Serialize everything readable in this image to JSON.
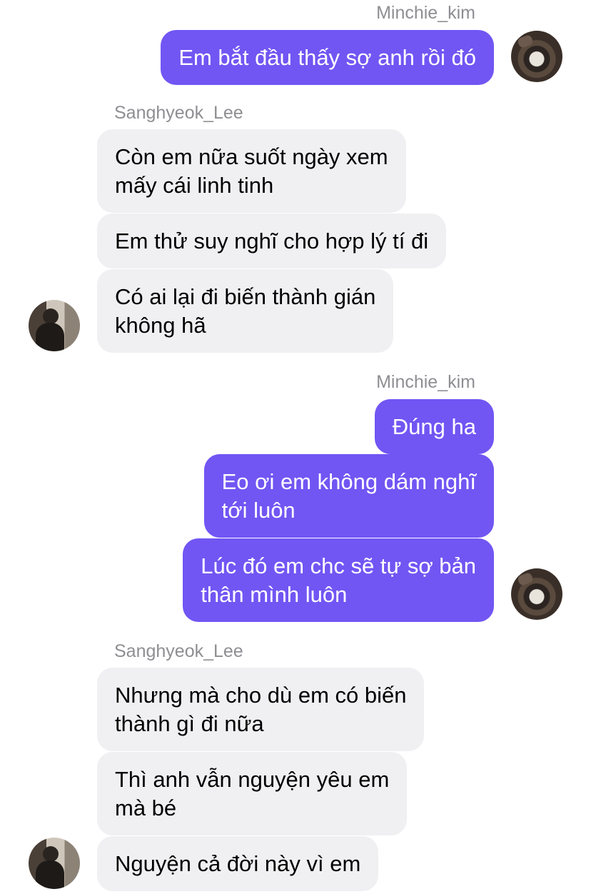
{
  "participants": {
    "me": "Minchie_kim",
    "other": "Sanghyeok_Lee"
  },
  "groups": [
    {
      "sender_label": "Minchie_kim",
      "messages": [
        "Em bắt đầu thấy sợ anh rồi đó"
      ]
    },
    {
      "sender_label": "Sanghyeok_Lee",
      "messages": [
        "Còn em nữa suốt ngày xem\nmấy cái linh tinh",
        "Em thử suy nghĩ cho hợp lý tí đi",
        "Có ai lại đi biến thành gián\nkhông hã"
      ]
    },
    {
      "sender_label": "Minchie_kim",
      "messages": [
        "Đúng ha",
        "Eo ơi em không dám nghĩ\ntới luôn",
        "Lúc đó em chc sẽ tự sợ bản\nthân mình luôn"
      ]
    },
    {
      "sender_label": "Sanghyeok_Lee",
      "messages": [
        "Nhưng mà cho dù em có biến\nthành gì đi nữa",
        "Thì anh vẫn nguyện yêu em\nmà bé",
        "Nguyện cả đời này vì em"
      ]
    }
  ],
  "colors": {
    "outgoing_bubble": "#7156f3",
    "incoming_bubble": "#f0f0f2",
    "name_label": "#8e8e93"
  }
}
